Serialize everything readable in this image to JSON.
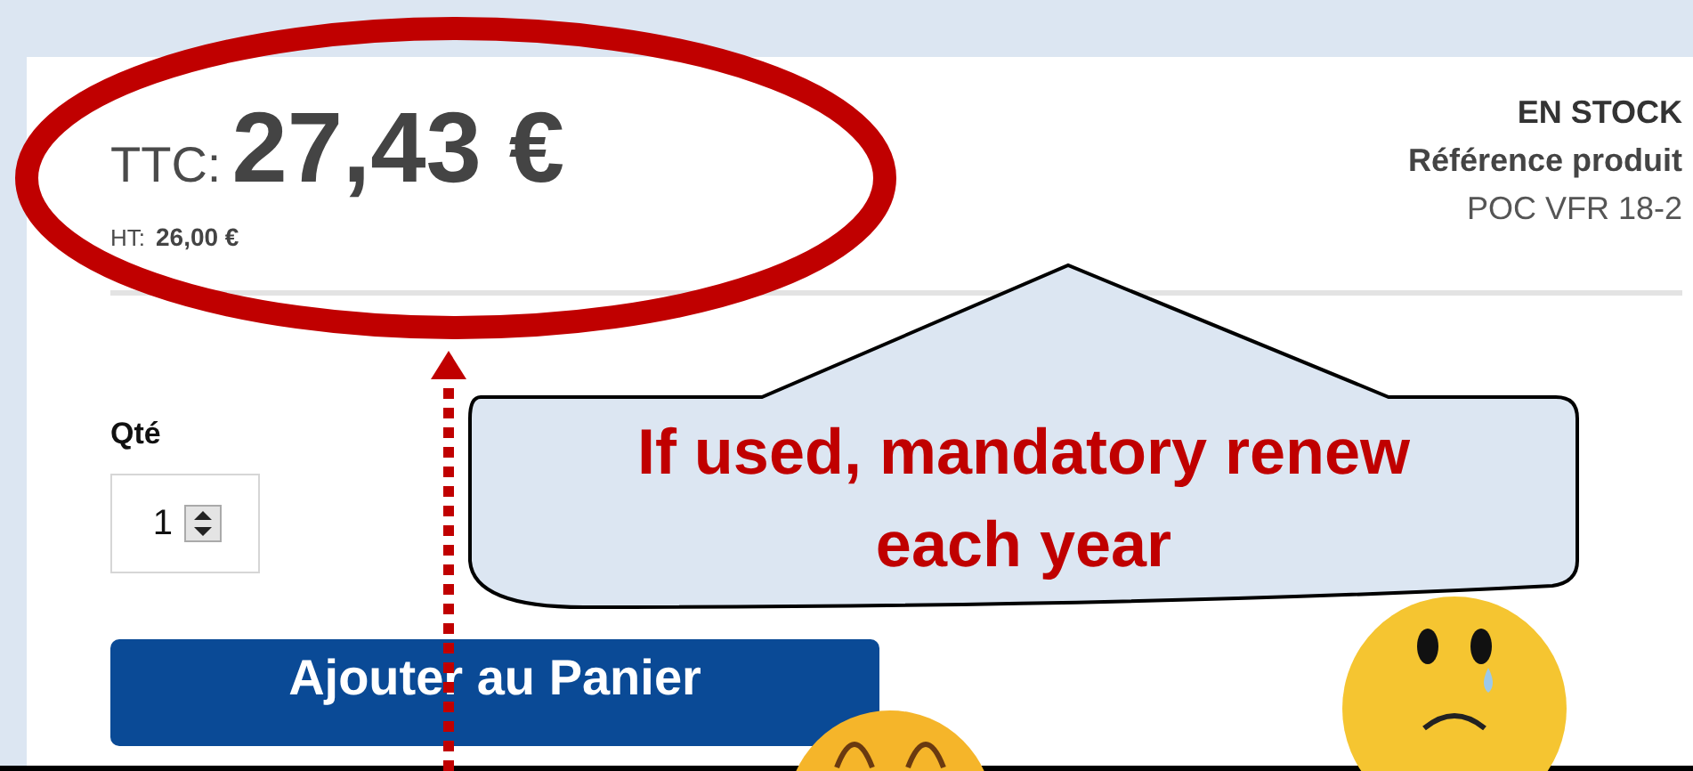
{
  "price": {
    "label": "TTC:",
    "amount": "27,43 €"
  },
  "net_price": {
    "label": "HT:",
    "amount": "26,00 €"
  },
  "availability": "EN STOCK",
  "reference": {
    "label": "Référence produit",
    "value": "POC VFR 18-2"
  },
  "quantity": {
    "label": "Qté",
    "value": "1"
  },
  "add_to_cart": {
    "label": "Ajouter au Panier"
  },
  "callout": {
    "text": "If used, mandatory renew each year"
  }
}
